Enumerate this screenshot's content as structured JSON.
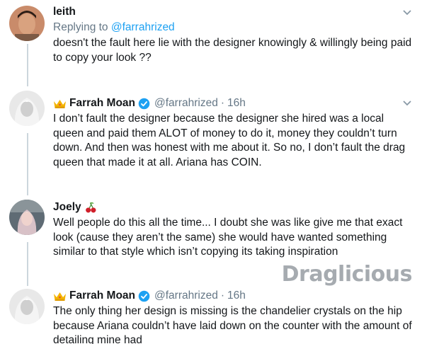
{
  "tweets": [
    {
      "name": "leith",
      "replying_prefix": "Replying to",
      "replying_handle": "@farrahrized",
      "text": "doesn't the fault here lie with the designer knowingly & willingly being paid to copy your look ??",
      "avatar_icon": "profile-photo"
    },
    {
      "name": "Farrah Moan",
      "handle": "@farrahrized",
      "separator": "·",
      "time": "16h",
      "name_prefix_icon": "crown-emoji",
      "verified": true,
      "text": "I don’t fault the designer because the designer she hired was a local queen and paid them ALOT of money to do it, money they couldn’t turn down. And then was honest with me about it. So no, I don’t fault the drag queen that made it at all. Ariana has COIN.",
      "avatar_icon": "profile-photo"
    },
    {
      "name": "Joely",
      "name_suffix_icon": "cherries-emoji",
      "text": "Well people do this all the time... I doubt she was like give me that exact look (cause they aren’t the same) she would have wanted something similar to that style which isn’t copying its taking inspiration",
      "avatar_icon": "profile-photo"
    },
    {
      "name": "Farrah Moan",
      "handle": "@farrahrized",
      "separator": "·",
      "time": "16h",
      "name_prefix_icon": "crown-emoji",
      "verified": true,
      "text": "The only thing her design is missing is the chandelier crystals on the hip because Ariana couldn’t have laid down on the counter with the amount of detailing mine had",
      "avatar_icon": "profile-photo"
    }
  ],
  "watermark": "Draglicious",
  "colors": {
    "link": "#1da1f2",
    "secondary_text": "#657786",
    "thread_line": "#ccd6dd",
    "verified": "#1da1f2"
  }
}
